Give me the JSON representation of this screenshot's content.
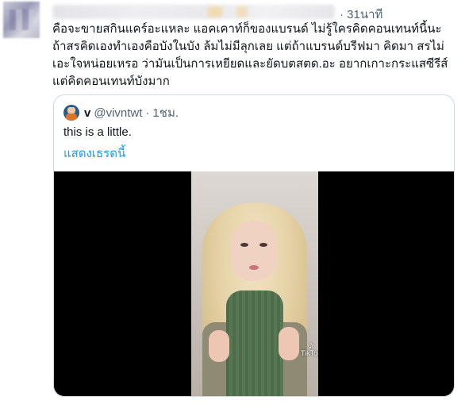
{
  "tweet": {
    "timestamp": "· 31นาที",
    "text": "คือจะขายสกินแคร์อะแหละ แอคเคาท์ก็ของแบรนด์ ไม่รู้ใครคิดคอนเทนท์นี้นะ ถ้าสรคิดเองทำเองคือบังในบัง ล้มไม่มีลุกเลย แต่ถ้าแบรนด์บรีฟมา คิดมา สรไม่เอะใจหน่อยเหรอ ว่ามันเป็นการเหยียดและยัดบตสตด.อะ อยากเกาะกระแสซีรีส์แต่คิดคอนเทนท์บังมาก"
  },
  "quote": {
    "name": "v",
    "handle": "@vivntwt",
    "separator": "·",
    "time": "1ชม.",
    "text": "this is a little.",
    "show_thread_label": "แสดงเธรดนี้"
  },
  "media": {
    "watermark_label": "TikTok",
    "watermark_icon": "tiktok-note-icon"
  },
  "colors": {
    "link": "#1d9bf0",
    "secondary_text": "#536471",
    "border": "#cfd9de"
  }
}
